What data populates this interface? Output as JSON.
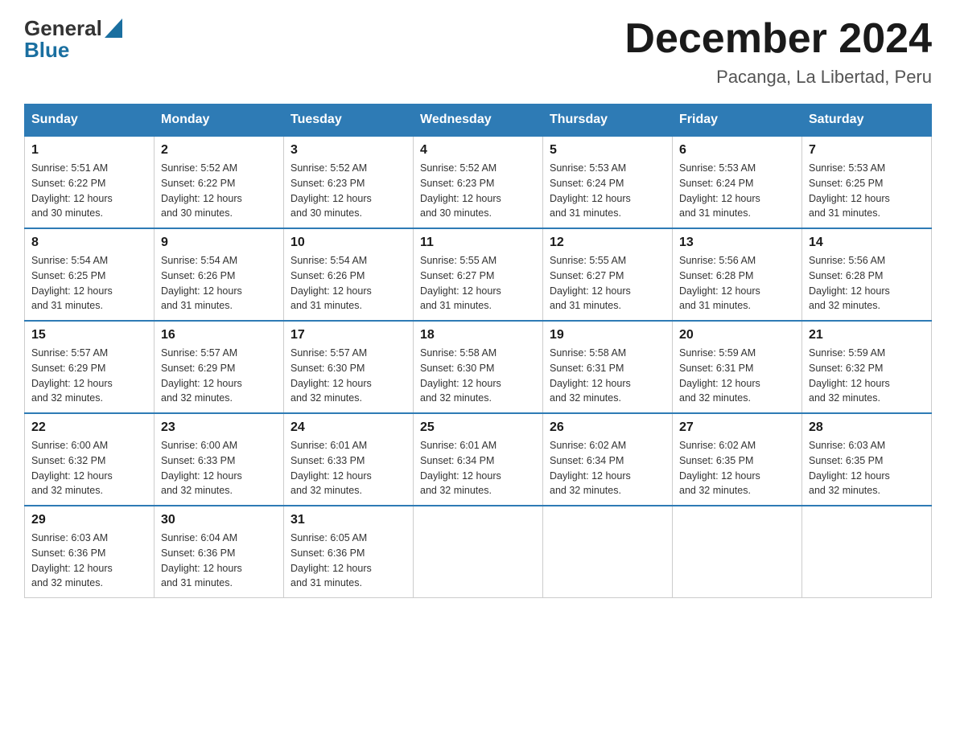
{
  "logo": {
    "line1": "General",
    "line2": "Blue"
  },
  "title": "December 2024",
  "subtitle": "Pacanga, La Libertad, Peru",
  "days_of_week": [
    "Sunday",
    "Monday",
    "Tuesday",
    "Wednesday",
    "Thursday",
    "Friday",
    "Saturday"
  ],
  "weeks": [
    [
      {
        "day": "1",
        "sunrise": "5:51 AM",
        "sunset": "6:22 PM",
        "daylight": "12 hours and 30 minutes."
      },
      {
        "day": "2",
        "sunrise": "5:52 AM",
        "sunset": "6:22 PM",
        "daylight": "12 hours and 30 minutes."
      },
      {
        "day": "3",
        "sunrise": "5:52 AM",
        "sunset": "6:23 PM",
        "daylight": "12 hours and 30 minutes."
      },
      {
        "day": "4",
        "sunrise": "5:52 AM",
        "sunset": "6:23 PM",
        "daylight": "12 hours and 30 minutes."
      },
      {
        "day": "5",
        "sunrise": "5:53 AM",
        "sunset": "6:24 PM",
        "daylight": "12 hours and 31 minutes."
      },
      {
        "day": "6",
        "sunrise": "5:53 AM",
        "sunset": "6:24 PM",
        "daylight": "12 hours and 31 minutes."
      },
      {
        "day": "7",
        "sunrise": "5:53 AM",
        "sunset": "6:25 PM",
        "daylight": "12 hours and 31 minutes."
      }
    ],
    [
      {
        "day": "8",
        "sunrise": "5:54 AM",
        "sunset": "6:25 PM",
        "daylight": "12 hours and 31 minutes."
      },
      {
        "day": "9",
        "sunrise": "5:54 AM",
        "sunset": "6:26 PM",
        "daylight": "12 hours and 31 minutes."
      },
      {
        "day": "10",
        "sunrise": "5:54 AM",
        "sunset": "6:26 PM",
        "daylight": "12 hours and 31 minutes."
      },
      {
        "day": "11",
        "sunrise": "5:55 AM",
        "sunset": "6:27 PM",
        "daylight": "12 hours and 31 minutes."
      },
      {
        "day": "12",
        "sunrise": "5:55 AM",
        "sunset": "6:27 PM",
        "daylight": "12 hours and 31 minutes."
      },
      {
        "day": "13",
        "sunrise": "5:56 AM",
        "sunset": "6:28 PM",
        "daylight": "12 hours and 31 minutes."
      },
      {
        "day": "14",
        "sunrise": "5:56 AM",
        "sunset": "6:28 PM",
        "daylight": "12 hours and 32 minutes."
      }
    ],
    [
      {
        "day": "15",
        "sunrise": "5:57 AM",
        "sunset": "6:29 PM",
        "daylight": "12 hours and 32 minutes."
      },
      {
        "day": "16",
        "sunrise": "5:57 AM",
        "sunset": "6:29 PM",
        "daylight": "12 hours and 32 minutes."
      },
      {
        "day": "17",
        "sunrise": "5:57 AM",
        "sunset": "6:30 PM",
        "daylight": "12 hours and 32 minutes."
      },
      {
        "day": "18",
        "sunrise": "5:58 AM",
        "sunset": "6:30 PM",
        "daylight": "12 hours and 32 minutes."
      },
      {
        "day": "19",
        "sunrise": "5:58 AM",
        "sunset": "6:31 PM",
        "daylight": "12 hours and 32 minutes."
      },
      {
        "day": "20",
        "sunrise": "5:59 AM",
        "sunset": "6:31 PM",
        "daylight": "12 hours and 32 minutes."
      },
      {
        "day": "21",
        "sunrise": "5:59 AM",
        "sunset": "6:32 PM",
        "daylight": "12 hours and 32 minutes."
      }
    ],
    [
      {
        "day": "22",
        "sunrise": "6:00 AM",
        "sunset": "6:32 PM",
        "daylight": "12 hours and 32 minutes."
      },
      {
        "day": "23",
        "sunrise": "6:00 AM",
        "sunset": "6:33 PM",
        "daylight": "12 hours and 32 minutes."
      },
      {
        "day": "24",
        "sunrise": "6:01 AM",
        "sunset": "6:33 PM",
        "daylight": "12 hours and 32 minutes."
      },
      {
        "day": "25",
        "sunrise": "6:01 AM",
        "sunset": "6:34 PM",
        "daylight": "12 hours and 32 minutes."
      },
      {
        "day": "26",
        "sunrise": "6:02 AM",
        "sunset": "6:34 PM",
        "daylight": "12 hours and 32 minutes."
      },
      {
        "day": "27",
        "sunrise": "6:02 AM",
        "sunset": "6:35 PM",
        "daylight": "12 hours and 32 minutes."
      },
      {
        "day": "28",
        "sunrise": "6:03 AM",
        "sunset": "6:35 PM",
        "daylight": "12 hours and 32 minutes."
      }
    ],
    [
      {
        "day": "29",
        "sunrise": "6:03 AM",
        "sunset": "6:36 PM",
        "daylight": "12 hours and 32 minutes."
      },
      {
        "day": "30",
        "sunrise": "6:04 AM",
        "sunset": "6:36 PM",
        "daylight": "12 hours and 31 minutes."
      },
      {
        "day": "31",
        "sunrise": "6:05 AM",
        "sunset": "6:36 PM",
        "daylight": "12 hours and 31 minutes."
      },
      null,
      null,
      null,
      null
    ]
  ],
  "labels": {
    "sunrise": "Sunrise:",
    "sunset": "Sunset:",
    "daylight": "Daylight:"
  }
}
